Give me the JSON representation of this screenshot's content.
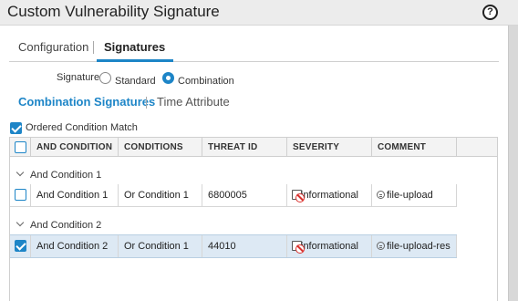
{
  "dialog": {
    "title": "Custom Vulnerability Signature",
    "help_label": "?"
  },
  "tabs": [
    {
      "label": "Configuration",
      "active": false
    },
    {
      "label": "Signatures",
      "active": true
    }
  ],
  "signature_type": {
    "label": "Signature",
    "options": [
      {
        "label": "Standard",
        "selected": false
      },
      {
        "label": "Combination",
        "selected": true
      }
    ]
  },
  "subtabs": [
    {
      "label": "Combination Signatures",
      "active": true
    },
    {
      "label": "Time Attribute",
      "active": false
    }
  ],
  "ordered_condition_match": {
    "label": "Ordered Condition Match",
    "checked": true
  },
  "grid": {
    "columns": [
      "AND CONDITION",
      "CONDITIONS",
      "THREAT ID",
      "SEVERITY",
      "COMMENT"
    ],
    "groups": [
      {
        "label": "And Condition 1",
        "rows": [
          {
            "and_condition": "And Condition 1",
            "conditions": "Or Condition 1",
            "threat_id": "6800005",
            "severity": "informational",
            "comment": "file-upload",
            "checked": false,
            "selected": false
          }
        ]
      },
      {
        "label": "And Condition 2",
        "rows": [
          {
            "and_condition": "And Condition 2",
            "conditions": "Or Condition 1",
            "threat_id": "44010",
            "severity": "informational",
            "comment": "file-upload-res",
            "checked": true,
            "selected": true
          }
        ]
      }
    ]
  },
  "colors": {
    "accent": "#1d85c7",
    "selected_row": "#dde9f4",
    "header_bg": "#f3f3f3",
    "severity_icon": "#d9302c"
  },
  "icons": {
    "help": "help-icon",
    "group_toggle": "chevron-down-icon",
    "severity": "informational-severity-icon",
    "comment": "comment-icon"
  }
}
